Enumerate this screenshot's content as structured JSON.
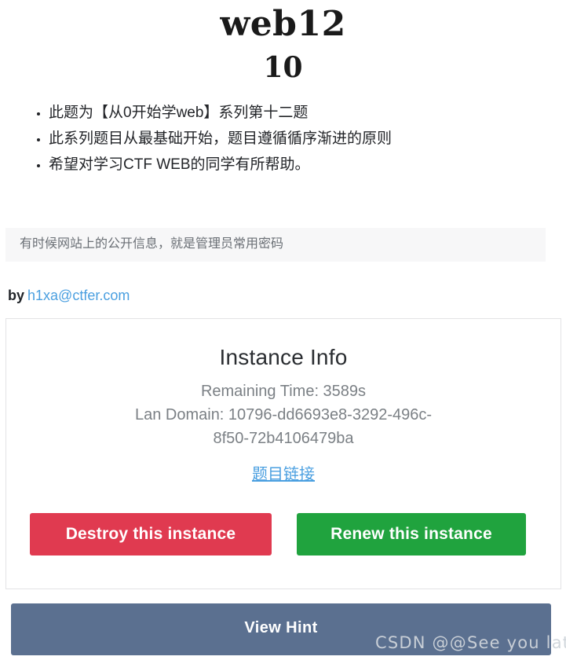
{
  "header": {
    "title": "web12",
    "points": "10"
  },
  "description": {
    "items": [
      "此题为【从0开始学web】系列第十二题",
      "此系列题目从最基础开始，题目遵循循序渐进的原则",
      "希望对学习CTF WEB的同学有所帮助。"
    ]
  },
  "hint_box": {
    "text": "有时候网站上的公开信息，就是管理员常用密码"
  },
  "author": {
    "prefix": "by",
    "email": "h1xa@ctfer.com"
  },
  "instance": {
    "title": "Instance Info",
    "remaining_time_label": "Remaining Time: 3589s",
    "lan_domain_line1": "Lan Domain: 10796-dd6693e8-3292-496c-",
    "lan_domain_line2": "8f50-72b4106479ba",
    "challenge_link": "题目链接",
    "destroy_button": "Destroy this instance",
    "renew_button": "Renew this instance"
  },
  "footer": {
    "view_hint_button": "View Hint"
  },
  "watermark": {
    "text": "CSDN @@See  you   later"
  },
  "colors": {
    "destroy": "#e03a50",
    "renew": "#20a33e",
    "view_hint": "#5b7090",
    "link": "#4a9fe0",
    "hint_box_bg": "#f7f7f8"
  }
}
